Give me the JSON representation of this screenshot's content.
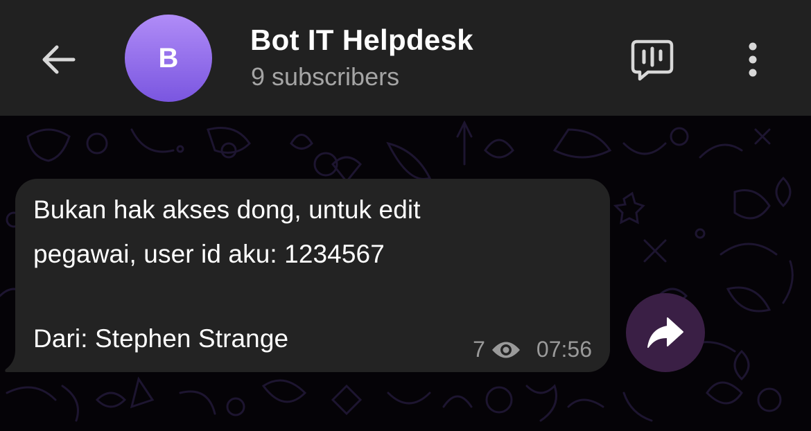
{
  "header": {
    "back_icon": "arrow-left-icon",
    "avatar_letter": "B",
    "avatar_gradient": [
      "#b08cf7",
      "#7a56e0"
    ],
    "title": "Bot IT Helpdesk",
    "subtitle": "9 subscribers",
    "voice_chat_icon": "voice-chat-icon",
    "more_icon": "more-vertical-icon"
  },
  "message": {
    "lines": [
      "Bukan hak akses dong, untuk edit",
      "pegawai, user id aku: 1234567",
      "",
      "Dari: Stephen Strange"
    ],
    "views": "7",
    "time": "07:56",
    "eye_icon": "eye-icon",
    "share_icon": "share-arrow-icon"
  },
  "colors": {
    "header_bg": "#212121",
    "bubble_bg": "#232323",
    "share_bg": "#3a1f45",
    "chat_bg": "#050307"
  }
}
